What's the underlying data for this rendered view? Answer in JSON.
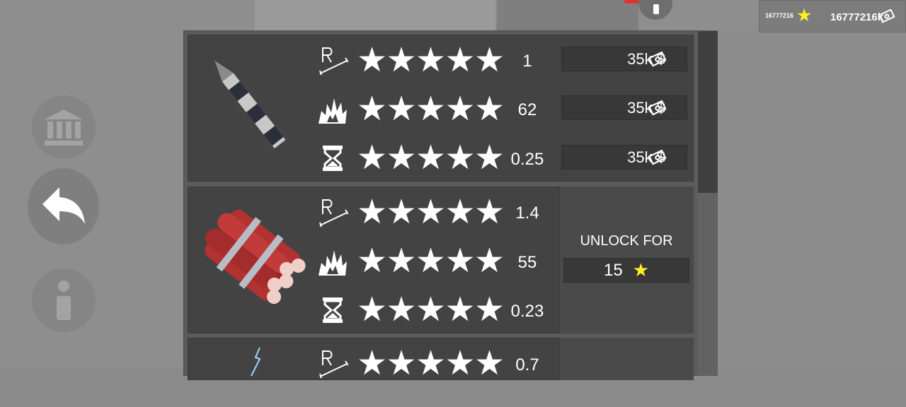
{
  "currency": {
    "stars": "16777216",
    "money": "16777216k"
  },
  "weapons": [
    {
      "name_icon": "missile-icon",
      "stats": [
        {
          "icon": "range-icon",
          "stars": 5,
          "value": "1",
          "price": "35k $"
        },
        {
          "icon": "explosion-icon",
          "stars": 5,
          "value": "62",
          "price": "35k $"
        },
        {
          "icon": "hourglass-icon",
          "stars": 5,
          "value": "0.25",
          "price": "35k $"
        }
      ]
    },
    {
      "name_icon": "dynamite-icon",
      "stats": [
        {
          "icon": "range-icon",
          "stars": 5,
          "value": "1.4"
        },
        {
          "icon": "explosion-icon",
          "stars": 5,
          "value": "55"
        },
        {
          "icon": "hourglass-icon",
          "stars": 5,
          "value": "0.23"
        }
      ],
      "unlock_label": "UNLOCK FOR",
      "unlock_cost": "15"
    },
    {
      "name_icon": "lightning-icon",
      "stats": [
        {
          "icon": "range-icon",
          "stars": 5,
          "value": "0.7"
        }
      ]
    }
  ],
  "colors": {
    "star_yellow": "#ffef22",
    "panel": "#5b5b5b",
    "row": "#434343"
  }
}
